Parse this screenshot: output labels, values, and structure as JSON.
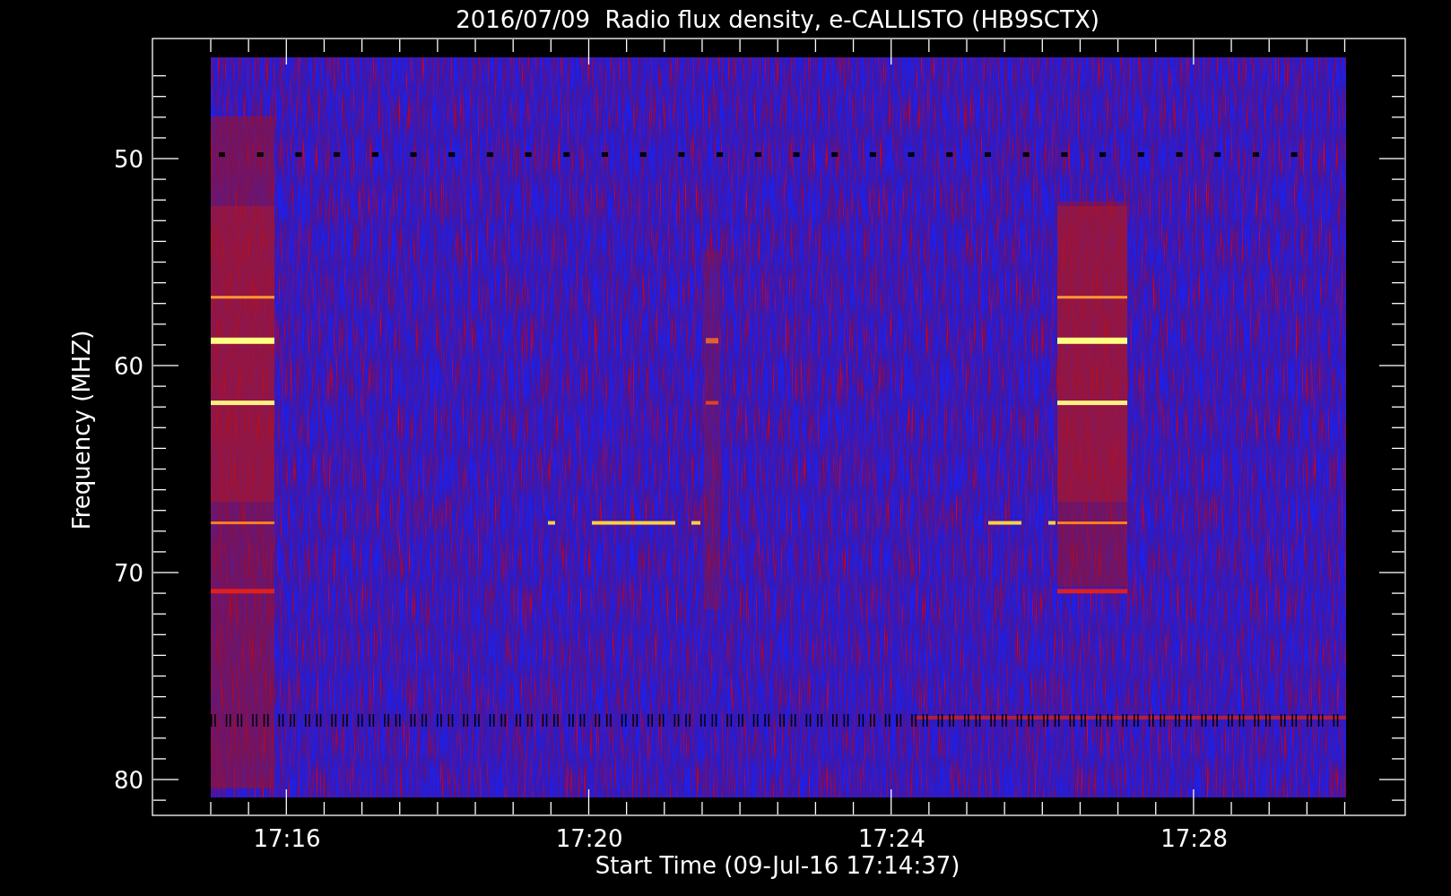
{
  "title": "2016/07/09  Radio flux density, e-CALLISTO (HB9SCTX)",
  "ylabel": "Frequency (MHZ)",
  "xlabel": "Start Time (09-Jul-16 17:14:37)",
  "yticks": [
    "50",
    "60",
    "70",
    "80"
  ],
  "xticks": [
    "17:16",
    "17:20",
    "17:24",
    "17:28"
  ]
}
